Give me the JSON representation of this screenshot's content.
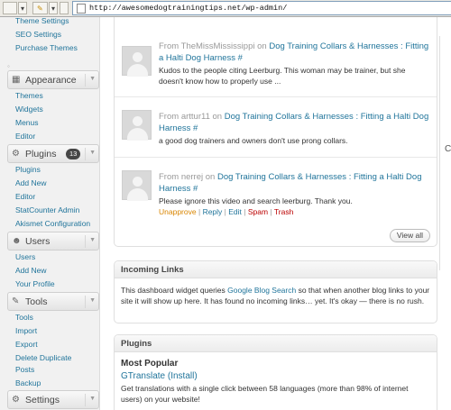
{
  "browser": {
    "url": "http://awesomedogtrainingtips.net/wp-admin/"
  },
  "sidebar": {
    "top_items": [
      "Theme Settings",
      "SEO Settings",
      "Purchase Themes"
    ],
    "sections": [
      {
        "title": "Appearance",
        "icon": "appearance-icon",
        "items": [
          "Themes",
          "Widgets",
          "Menus",
          "Editor"
        ]
      },
      {
        "title": "Plugins",
        "icon": "plugins-icon",
        "badge": "13",
        "items": [
          "Plugins",
          "Add New",
          "Editor",
          "StatCounter Admin",
          "Akismet Configuration"
        ]
      },
      {
        "title": "Users",
        "icon": "users-icon",
        "items": [
          "Users",
          "Add New",
          "Your Profile"
        ]
      },
      {
        "title": "Tools",
        "icon": "tools-icon",
        "items": [
          "Tools",
          "Import",
          "Export",
          "Delete Duplicate",
          "Posts",
          "Backup"
        ]
      },
      {
        "title": "Settings",
        "icon": "settings-icon",
        "items": []
      }
    ]
  },
  "comments": [
    {
      "from": "From",
      "author": "TheMissMississippi",
      "on": "on",
      "post_title": "Dog Training Collars & Harnesses : Fitting a Halti Dog Harness #",
      "text": "Kudos to the people citing Leerburg. This woman may be trainer, but she doesn't know how to properly use ..."
    },
    {
      "from": "From",
      "author": "arttur11",
      "on": "on",
      "post_title": "Dog Training Collars & Harnesses : Fitting a Halti Dog Harness #",
      "text": "a good dog trainers and owners don't use prong collars."
    },
    {
      "from": "From",
      "author": "nerrej",
      "on": "on",
      "post_title": "Dog Training Collars & Harnesses : Fitting a Halti Dog Harness #",
      "text": "Please ignore this video and search leerburg. Thank you."
    }
  ],
  "comment_actions": {
    "unapprove": "Unapprove",
    "reply": "Reply",
    "edit": "Edit",
    "spam": "Spam",
    "trash": "Trash",
    "separator": "|"
  },
  "view_all_label": "View all",
  "incoming_links": {
    "title": "Incoming Links",
    "text_before": "This dashboard widget queries",
    "link": "Google Blog Search",
    "text_after": "so that when another blog links to your site it will show up here. It has found no incoming links… yet. It's okay — there is no rush."
  },
  "plugins_widget": {
    "title": "Plugins",
    "heading": "Most Popular",
    "plugin_name": "GTranslate",
    "install_label": "(Install)",
    "description": "Get translations with a single click between 58 languages (more than 98% of internet users) on your website!"
  }
}
